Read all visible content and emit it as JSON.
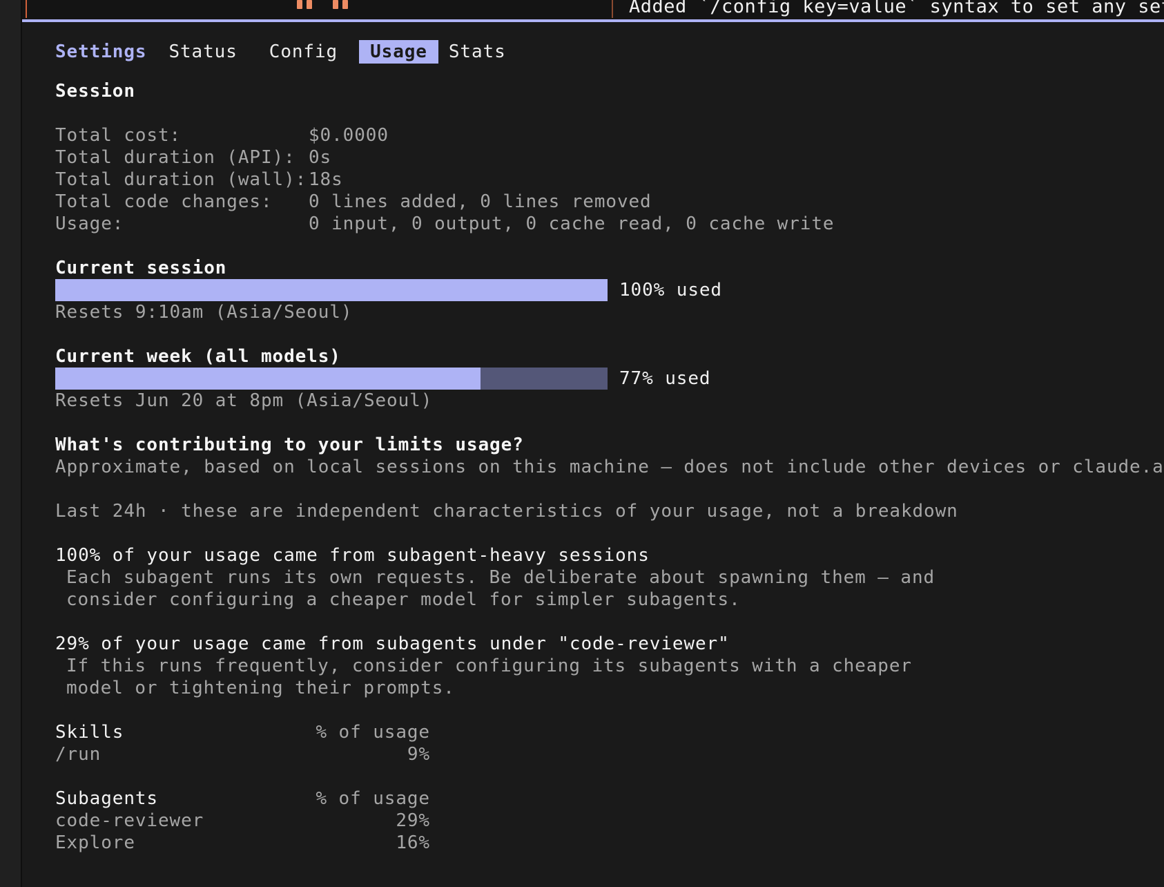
{
  "top_strip": {
    "changelog_text": "Added `/config key=value` syntax to set any sett"
  },
  "tabs": {
    "settings": "Settings",
    "items": [
      "Status",
      "Config",
      "Usage",
      "Stats"
    ],
    "active": "Usage"
  },
  "session": {
    "heading": "Session",
    "rows": [
      {
        "label": "Total cost:",
        "value": "$0.0000"
      },
      {
        "label": "Total duration (API):",
        "value": "0s"
      },
      {
        "label": "Total duration (wall):",
        "value": "18s"
      },
      {
        "label": "Total code changes:",
        "value": "0 lines added, 0 lines removed"
      },
      {
        "label": "Usage:",
        "value": "0 input, 0 output, 0 cache read, 0 cache write"
      }
    ]
  },
  "current_session": {
    "heading": "Current session",
    "used_fraction": 1.0,
    "used_label": "100% used",
    "resets": "Resets 9:10am (Asia/Seoul)"
  },
  "current_week": {
    "heading": "Current week (all models)",
    "used_fraction": 0.77,
    "used_label": "77% used",
    "resets": "Resets Jun 20 at 8pm (Asia/Seoul)"
  },
  "contributing": {
    "heading": "What's contributing to your limits usage?",
    "note": "Approximate, based on local sessions on this machine — does not include other devices or claude.ai",
    "window_note": "Last 24h · these are independent characteristics of your usage, not a breakdown",
    "insights": [
      {
        "title": "100% of your usage came from subagent-heavy sessions",
        "lines": [
          "Each subagent runs its own requests. Be deliberate about spawning them — and",
          "consider configuring a cheaper model for simpler subagents."
        ]
      },
      {
        "title": "29% of your usage came from subagents under \"code-reviewer\"",
        "lines": [
          "If this runs frequently, consider configuring its subagents with a cheaper",
          "model or tightening their prompts."
        ]
      }
    ]
  },
  "skills_table": {
    "header": "Skills",
    "col_header": "% of usage",
    "rows": [
      {
        "name": "/run",
        "pct": "9%"
      }
    ]
  },
  "subagents_table": {
    "header": "Subagents",
    "col_header": "% of usage",
    "rows": [
      {
        "name": "code-reviewer",
        "pct": "29%"
      },
      {
        "name": "Explore",
        "pct": "16%"
      }
    ]
  },
  "colors": {
    "accent": "#aeb3f5",
    "bar_track": "#545778",
    "background": "#1a1a1a",
    "dim_text": "#a6a6a6"
  }
}
